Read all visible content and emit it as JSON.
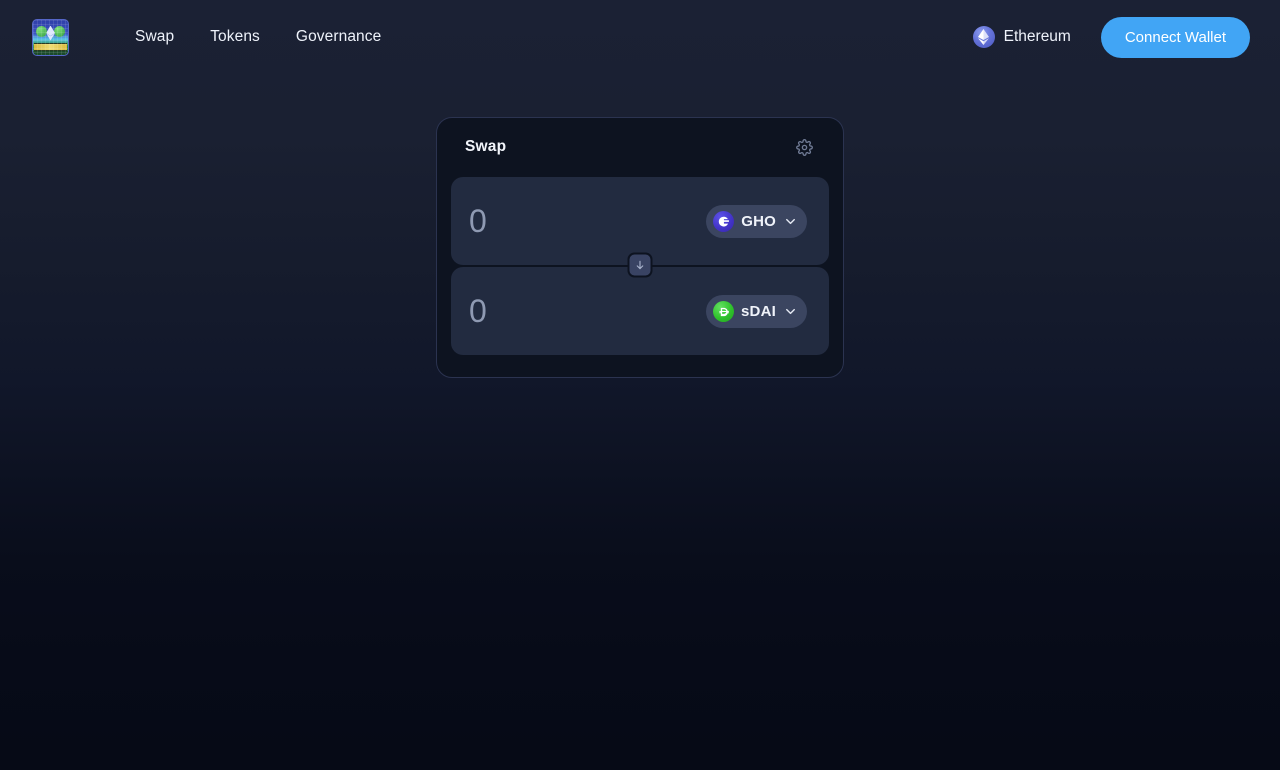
{
  "header": {
    "logo": {
      "icon": "app-logo-pixel-art"
    },
    "nav": [
      {
        "label": "Swap",
        "name": "nav-link-swap"
      },
      {
        "label": "Tokens",
        "name": "nav-link-tokens"
      },
      {
        "label": "Governance",
        "name": "nav-link-governance"
      }
    ],
    "chain": {
      "name": "Ethereum",
      "icon": "ethereum-icon",
      "color": "#6472d8"
    },
    "connect_wallet_label": "Connect Wallet",
    "connect_wallet_color": "#41a5f5"
  },
  "swap": {
    "title": "Swap",
    "settings_icon": "gear-icon",
    "direction_icon": "arrow-down-icon",
    "from": {
      "amount_value": "",
      "amount_placeholder": "0",
      "token_symbol": "GHO",
      "token_icon": "gho-token-icon",
      "token_color": "#4334c9",
      "chevron_icon": "chevron-down-icon"
    },
    "to": {
      "amount_value": "",
      "amount_placeholder": "0",
      "token_symbol": "sDAI",
      "token_icon": "sdai-token-icon",
      "token_color": "#2fc22b",
      "chevron_icon": "chevron-down-icon"
    }
  }
}
